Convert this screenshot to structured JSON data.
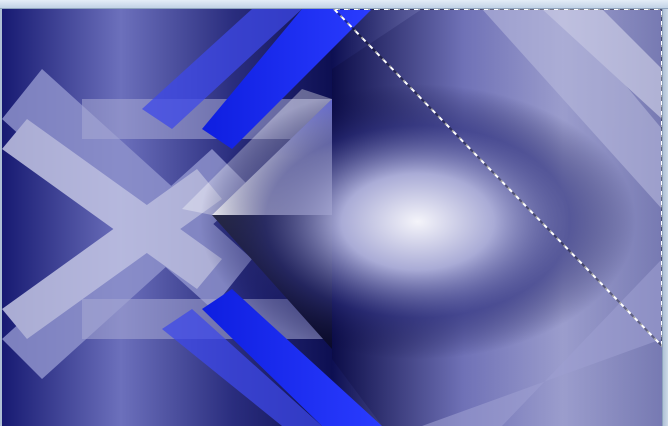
{
  "window": {
    "title": ""
  },
  "canvas": {
    "image": "abstract-blue-kaleidoscope-pattern",
    "colors": {
      "deep": "#141668",
      "navy": "#0a0a40",
      "blue": "#1a2cf0",
      "lavender": "#8c90d0",
      "silver": "#e2e3ef",
      "white": "#ffffff"
    },
    "selection": "diagonal-marquee"
  }
}
